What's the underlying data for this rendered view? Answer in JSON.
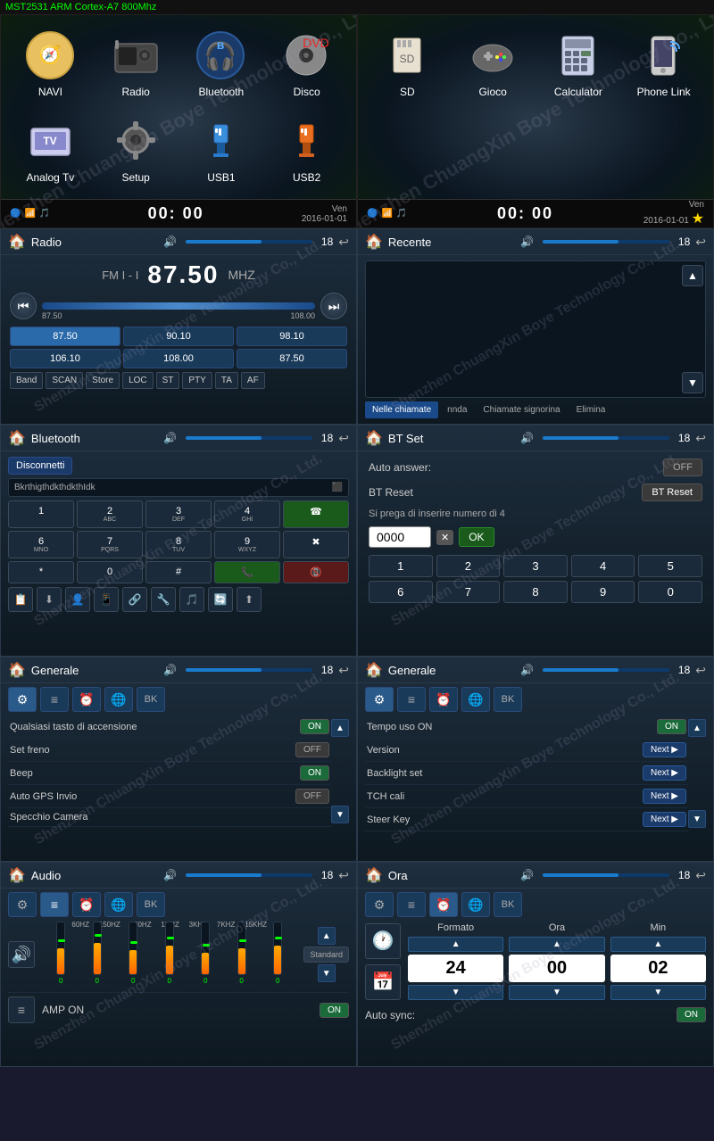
{
  "topbar": {
    "title": "MST2531 ARM Cortex-A7 800Mhz"
  },
  "watermark": "Shenzhen ChuangXin Boye Technology Co., Ltd.",
  "panel1": {
    "apps": [
      {
        "label": "NAVI",
        "icon": "🧭"
      },
      {
        "label": "Radio",
        "icon": "📻"
      },
      {
        "label": "Bluetooth",
        "icon": "🎧"
      },
      {
        "label": "Disco",
        "icon": "💿"
      },
      {
        "label": "Analog Tv",
        "icon": "📺"
      },
      {
        "label": "Setup",
        "icon": "⚙️"
      },
      {
        "label": "USB1",
        "icon": "🔌"
      },
      {
        "label": "USB2",
        "icon": "🔌"
      }
    ],
    "statusbar": {
      "time": "00: 00",
      "date": "Ven\n2016-01-01"
    }
  },
  "panel2": {
    "apps": [
      {
        "label": "SD",
        "icon": "💾"
      },
      {
        "label": "Gioco",
        "icon": "🎮"
      },
      {
        "label": "Calculator",
        "icon": "🖩"
      },
      {
        "label": "Phone Link",
        "icon": "📱"
      }
    ],
    "statusbar": {
      "time": "00: 00",
      "date": "Ven\n2016-01-01"
    }
  },
  "radio": {
    "header": "Radio",
    "band": "FM I - I",
    "freq": "87.50",
    "unit": "MHZ",
    "range_min": "87.50",
    "range_max": "108.00",
    "presets": [
      "87.50",
      "90.10",
      "98.10",
      "106.10",
      "108.00",
      "87.50"
    ],
    "controls": [
      "Band",
      "SCAN",
      "Store",
      "LOC",
      "ST",
      "PTY",
      "TA",
      "AF"
    ],
    "num": "18"
  },
  "recente": {
    "header": "Recente",
    "tabs": [
      "Nelle chiamate",
      "nnda",
      "Chiamate signorina",
      "Elimina"
    ],
    "active_tab": 0,
    "num": "18"
  },
  "bluetooth": {
    "header": "Bluetooth",
    "disconnect_label": "Disconnetti",
    "device": "BkrthigthdkthdkthIdk",
    "keypad": [
      {
        "key": "1",
        "sub": ""
      },
      {
        "key": "2",
        "sub": "ABC"
      },
      {
        "key": "3",
        "sub": "DEF"
      },
      {
        "key": "4",
        "sub": "GHI"
      },
      {
        "key": "☎",
        "sub": ""
      },
      {
        "key": "6",
        "sub": "MNO"
      },
      {
        "key": "7",
        "sub": "PQRS"
      },
      {
        "key": "8",
        "sub": "TUV"
      },
      {
        "key": "9",
        "sub": "WXYZ"
      },
      {
        "key": "✖",
        "sub": ""
      },
      {
        "key": "*",
        "sub": ""
      },
      {
        "key": "0",
        "sub": ""
      },
      {
        "key": "#",
        "sub": ""
      },
      {
        "key": "📞",
        "sub": ""
      },
      {
        "key": "📵",
        "sub": ""
      }
    ],
    "num": "18"
  },
  "btset": {
    "header": "BT Set",
    "auto_answer_label": "Auto answer:",
    "auto_answer_value": "OFF",
    "bt_reset_label": "BT Reset",
    "bt_reset_btn": "BT Reset",
    "hint": "Si prega di inserire numero di 4",
    "pin": "0000",
    "ok_btn": "OK",
    "numpad_row1": [
      "1",
      "2",
      "3",
      "4",
      "5"
    ],
    "numpad_row2": [
      "6",
      "7",
      "8",
      "9",
      "0"
    ],
    "num": "18"
  },
  "generale1": {
    "header": "Generale",
    "tabs": [
      "⚙",
      "≡",
      "⏰",
      "🌐",
      "BK"
    ],
    "rows": [
      {
        "label": "Qualsiasi tasto di accensione",
        "ctrl": "ON",
        "type": "toggle"
      },
      {
        "label": "Set freno",
        "ctrl": "OFF",
        "type": "toggle"
      },
      {
        "label": "Beep",
        "ctrl": "ON",
        "type": "toggle"
      },
      {
        "label": "Auto GPS Invio",
        "ctrl": "OFF",
        "type": "toggle"
      },
      {
        "label": "Specchio Camera",
        "ctrl": "",
        "type": "none"
      }
    ],
    "num": "18"
  },
  "generale2": {
    "header": "Generale",
    "tabs": [
      "⚙",
      "≡",
      "⏰",
      "🌐",
      "BK"
    ],
    "rows": [
      {
        "label": "Tempo uso ON",
        "ctrl": "ON",
        "type": "toggle"
      },
      {
        "label": "Version",
        "ctrl": "Next",
        "type": "next"
      },
      {
        "label": "Backlight set",
        "ctrl": "Next",
        "type": "next"
      },
      {
        "label": "TCH cali",
        "ctrl": "Next",
        "type": "next"
      },
      {
        "label": "Steer Key",
        "ctrl": "Next",
        "type": "next"
      }
    ],
    "num": "18"
  },
  "audio": {
    "header": "Audio",
    "tabs": [
      "⚙",
      "≡",
      "⏰",
      "🌐",
      "BK"
    ],
    "eq_labels": [
      "60HZ",
      "150HZ",
      "400HZ",
      "1KHZ",
      "3KHZ",
      "7KHZ",
      "15KHZ"
    ],
    "eq_values": [
      50,
      60,
      45,
      55,
      40,
      50,
      55
    ],
    "eq_dots": [
      35,
      42,
      30,
      40,
      25,
      35,
      38
    ],
    "amp_label": "AMP ON",
    "amp_value": "ON",
    "preset": "Standard",
    "num": "18"
  },
  "ora": {
    "header": "Ora",
    "tabs": [
      "⚙",
      "≡",
      "⏰",
      "🌐",
      "BK"
    ],
    "formato_label": "Formato",
    "ora_label": "Ora",
    "min_label": "Min",
    "formato_val": "24",
    "ora_val": "00",
    "min_val": "02",
    "auto_sync_label": "Auto sync:",
    "auto_sync_value": "ON",
    "num": "18"
  }
}
